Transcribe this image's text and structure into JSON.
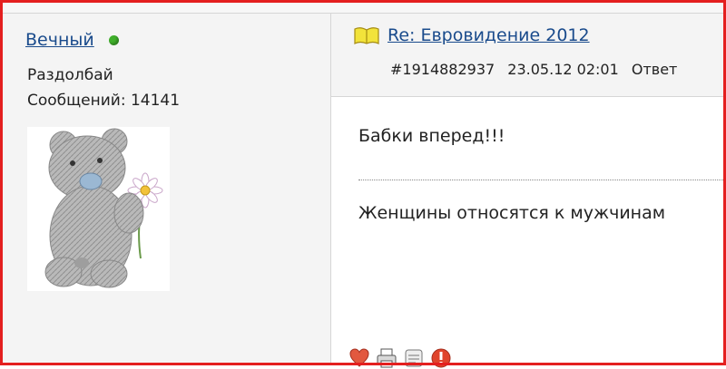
{
  "user": {
    "name": "Вечный",
    "status": "online",
    "rank": "Раздолбай",
    "posts_label": "Сообщений: 14141"
  },
  "post": {
    "title": "Re: Евровидение 2012",
    "number": "#1914882937",
    "datetime": "23.05.12 02:01",
    "reply_label": "Ответ",
    "body": "Бабки вперед!!!",
    "signature": "Женщины относятся к мужчинам"
  },
  "icons": {
    "title_icon": "book-icon",
    "actions": [
      "heart-icon",
      "print-icon",
      "quote-icon",
      "report-icon"
    ]
  },
  "colors": {
    "link": "#1a4b8c",
    "online": "#3fae2a",
    "frame": "#e41f1f"
  }
}
